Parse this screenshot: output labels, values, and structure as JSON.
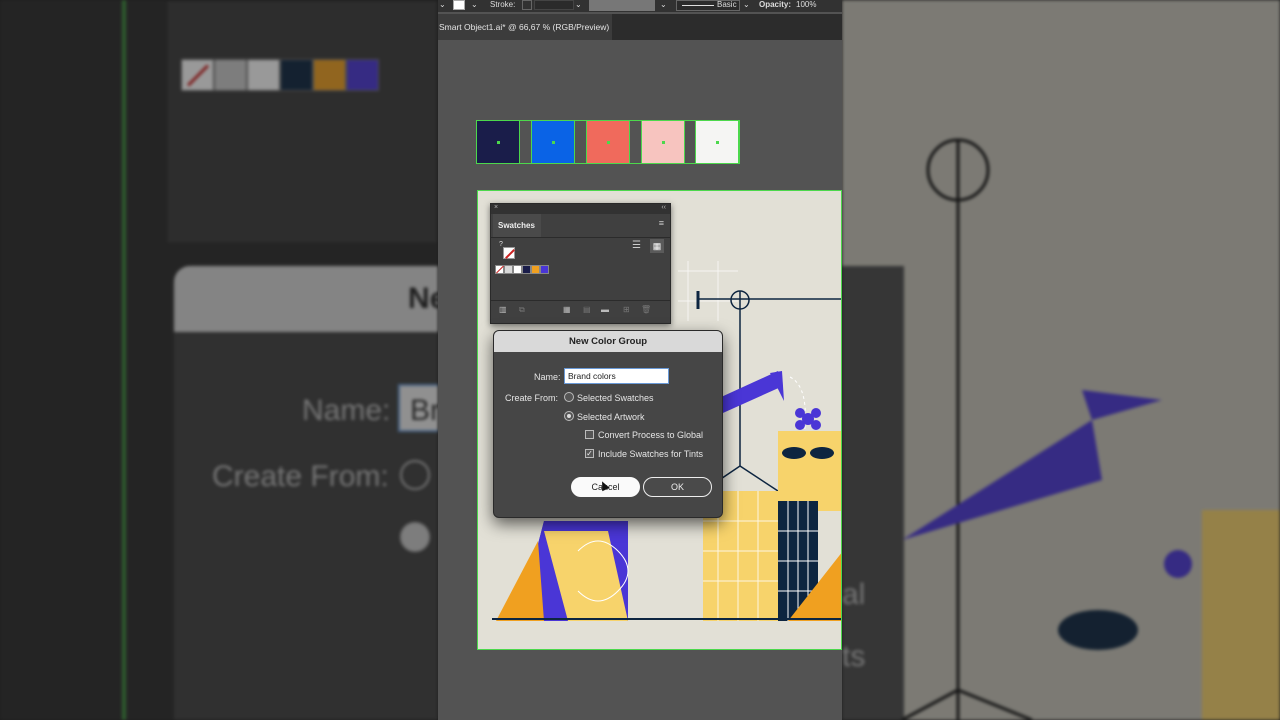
{
  "control_bar": {
    "stroke_label": "Stroke:",
    "brush_label": "Basic",
    "opacity_label": "Opacity:",
    "opacity_value": "100%"
  },
  "document_tab": {
    "title": "Smart Object1.ai* @ 66,67 % (RGB/Preview)"
  },
  "brand_swatches": {
    "colors": [
      "#1a1d4a",
      "#0a63e6",
      "#f06a5c",
      "#f7c4bf",
      "#f5f5f3"
    ]
  },
  "swatches_panel": {
    "tab_label": "Swatches",
    "mini_colors": [
      "#ffffff",
      "#d9d9d9",
      "#ffffff",
      "#1a1d4a",
      "#f0a020",
      "#4a36d6"
    ]
  },
  "dialog": {
    "title": "New Color Group",
    "name_label": "Name:",
    "name_value": "Brand colors",
    "create_from_label": "Create From:",
    "option_selected_swatches": "Selected Swatches",
    "option_selected_artwork": "Selected Artwork",
    "convert_process_label": "Convert Process to Global",
    "include_tints_label": "Include Swatches for Tints",
    "cancel_label": "Cancel",
    "ok_label": "OK"
  },
  "background_zoom": {
    "name_label": "Name:",
    "name_fragment": "Br",
    "create_from_label": "Create From:",
    "fragment_1": "al",
    "fragment_2": "ts",
    "title_fragment": "Ne"
  },
  "colors": {
    "selection_green": "#4cd84c",
    "navy": "#0d2540",
    "purple": "#4a36d6",
    "yellow": "#f7d36b",
    "orange": "#f0a020"
  }
}
